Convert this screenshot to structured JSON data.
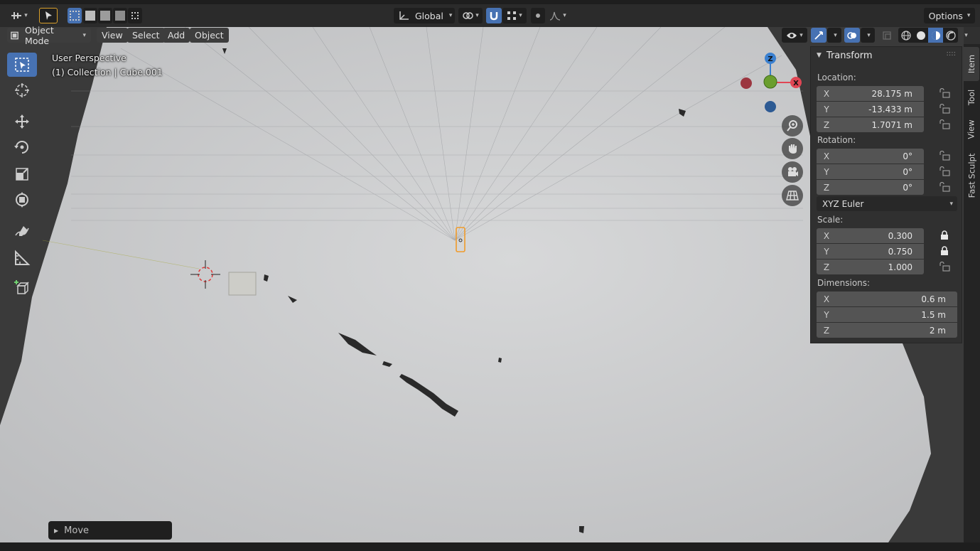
{
  "header": {
    "mode_label": "Object Mode",
    "menus": [
      "View",
      "Select",
      "Add",
      "Object"
    ],
    "orientation": "Global",
    "options_label": "Options"
  },
  "viewport": {
    "perspective_label": "User Perspective",
    "collection_label": "(1) Collection | Cube.001",
    "gizmo": {
      "z": "Z",
      "x": "X"
    }
  },
  "tools": [
    "select-box",
    "cursor",
    "move",
    "rotate",
    "scale",
    "transform",
    "annotate",
    "measure",
    "add-cube"
  ],
  "npanel": {
    "title": "Transform",
    "location": {
      "label": "Location:",
      "x": "28.175 m",
      "y": "-13.433 m",
      "z": "1.7071 m"
    },
    "rotation": {
      "label": "Rotation:",
      "x": "0°",
      "y": "0°",
      "z": "0°",
      "mode": "XYZ Euler"
    },
    "scale": {
      "label": "Scale:",
      "x": "0.300",
      "y": "0.750",
      "z": "1.000"
    },
    "dimensions": {
      "label": "Dimensions:",
      "x": "0.6 m",
      "y": "1.5 m",
      "z": "2 m"
    },
    "axes": {
      "x": "X",
      "y": "Y",
      "z": "Z"
    }
  },
  "tabs": [
    "Item",
    "Tool",
    "View",
    "Fast Sculpt"
  ],
  "operator_panel": {
    "label": "Move"
  },
  "colors": {
    "accent": "#4772b3",
    "selected_outline": "#f09b2a",
    "axis_x": "#e04654",
    "axis_y": "#6a9e2e",
    "axis_z": "#3a80d0"
  }
}
